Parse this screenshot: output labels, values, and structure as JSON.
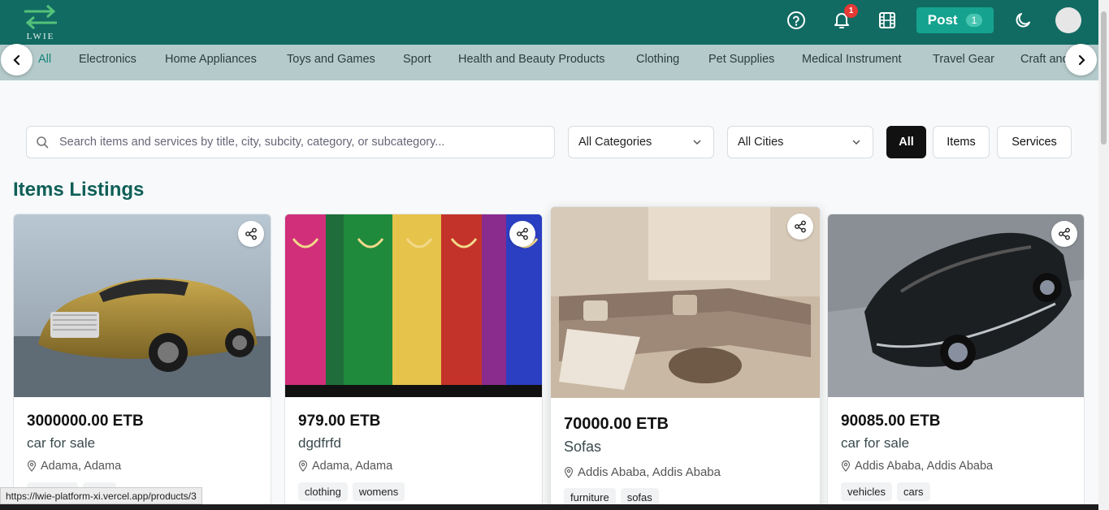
{
  "header": {
    "logo_text": "LWIE",
    "notification_count": "1",
    "post_label": "Post",
    "post_count": "1",
    "icons": [
      "help-icon",
      "bell-icon",
      "film-icon",
      "moon-icon",
      "avatar"
    ],
    "brand_color": "#116b63"
  },
  "categories": [
    "All",
    "Electronics",
    "Home Appliances",
    "Toys and Games",
    "Sport",
    "Health and Beauty Products",
    "Clothing",
    "Pet Supplies",
    "Medical Instrument",
    "Travel Gear",
    "Craft and"
  ],
  "search": {
    "placeholder": "Search items and services by title, city, subcity, category, or subcategory..."
  },
  "filters": {
    "category": "All Categories",
    "city": "All Cities",
    "type_buttons": [
      "All",
      "Items",
      "Services"
    ],
    "active_type": "All"
  },
  "section_title": "Items Listings",
  "listings": [
    {
      "price": "3000000.00 ETB",
      "title": "car for sale",
      "location": "Adama, Adama",
      "tags": [
        "vehicles",
        "cars"
      ]
    },
    {
      "price": "979.00 ETB",
      "title": "dgdfrfd",
      "location": "Adama, Adama",
      "tags": [
        "clothing",
        "womens"
      ]
    },
    {
      "price": "70000.00 ETB",
      "title": "Sofas",
      "location": "Addis Ababa, Addis Ababa",
      "tags": [
        "furniture",
        "sofas"
      ]
    },
    {
      "price": "90085.00 ETB",
      "title": "car for sale",
      "location": "Addis Ababa, Addis Ababa",
      "tags": [
        "vehicles",
        "cars"
      ]
    }
  ],
  "status_url": "https://lwie-platform-xi.vercel.app/products/3"
}
